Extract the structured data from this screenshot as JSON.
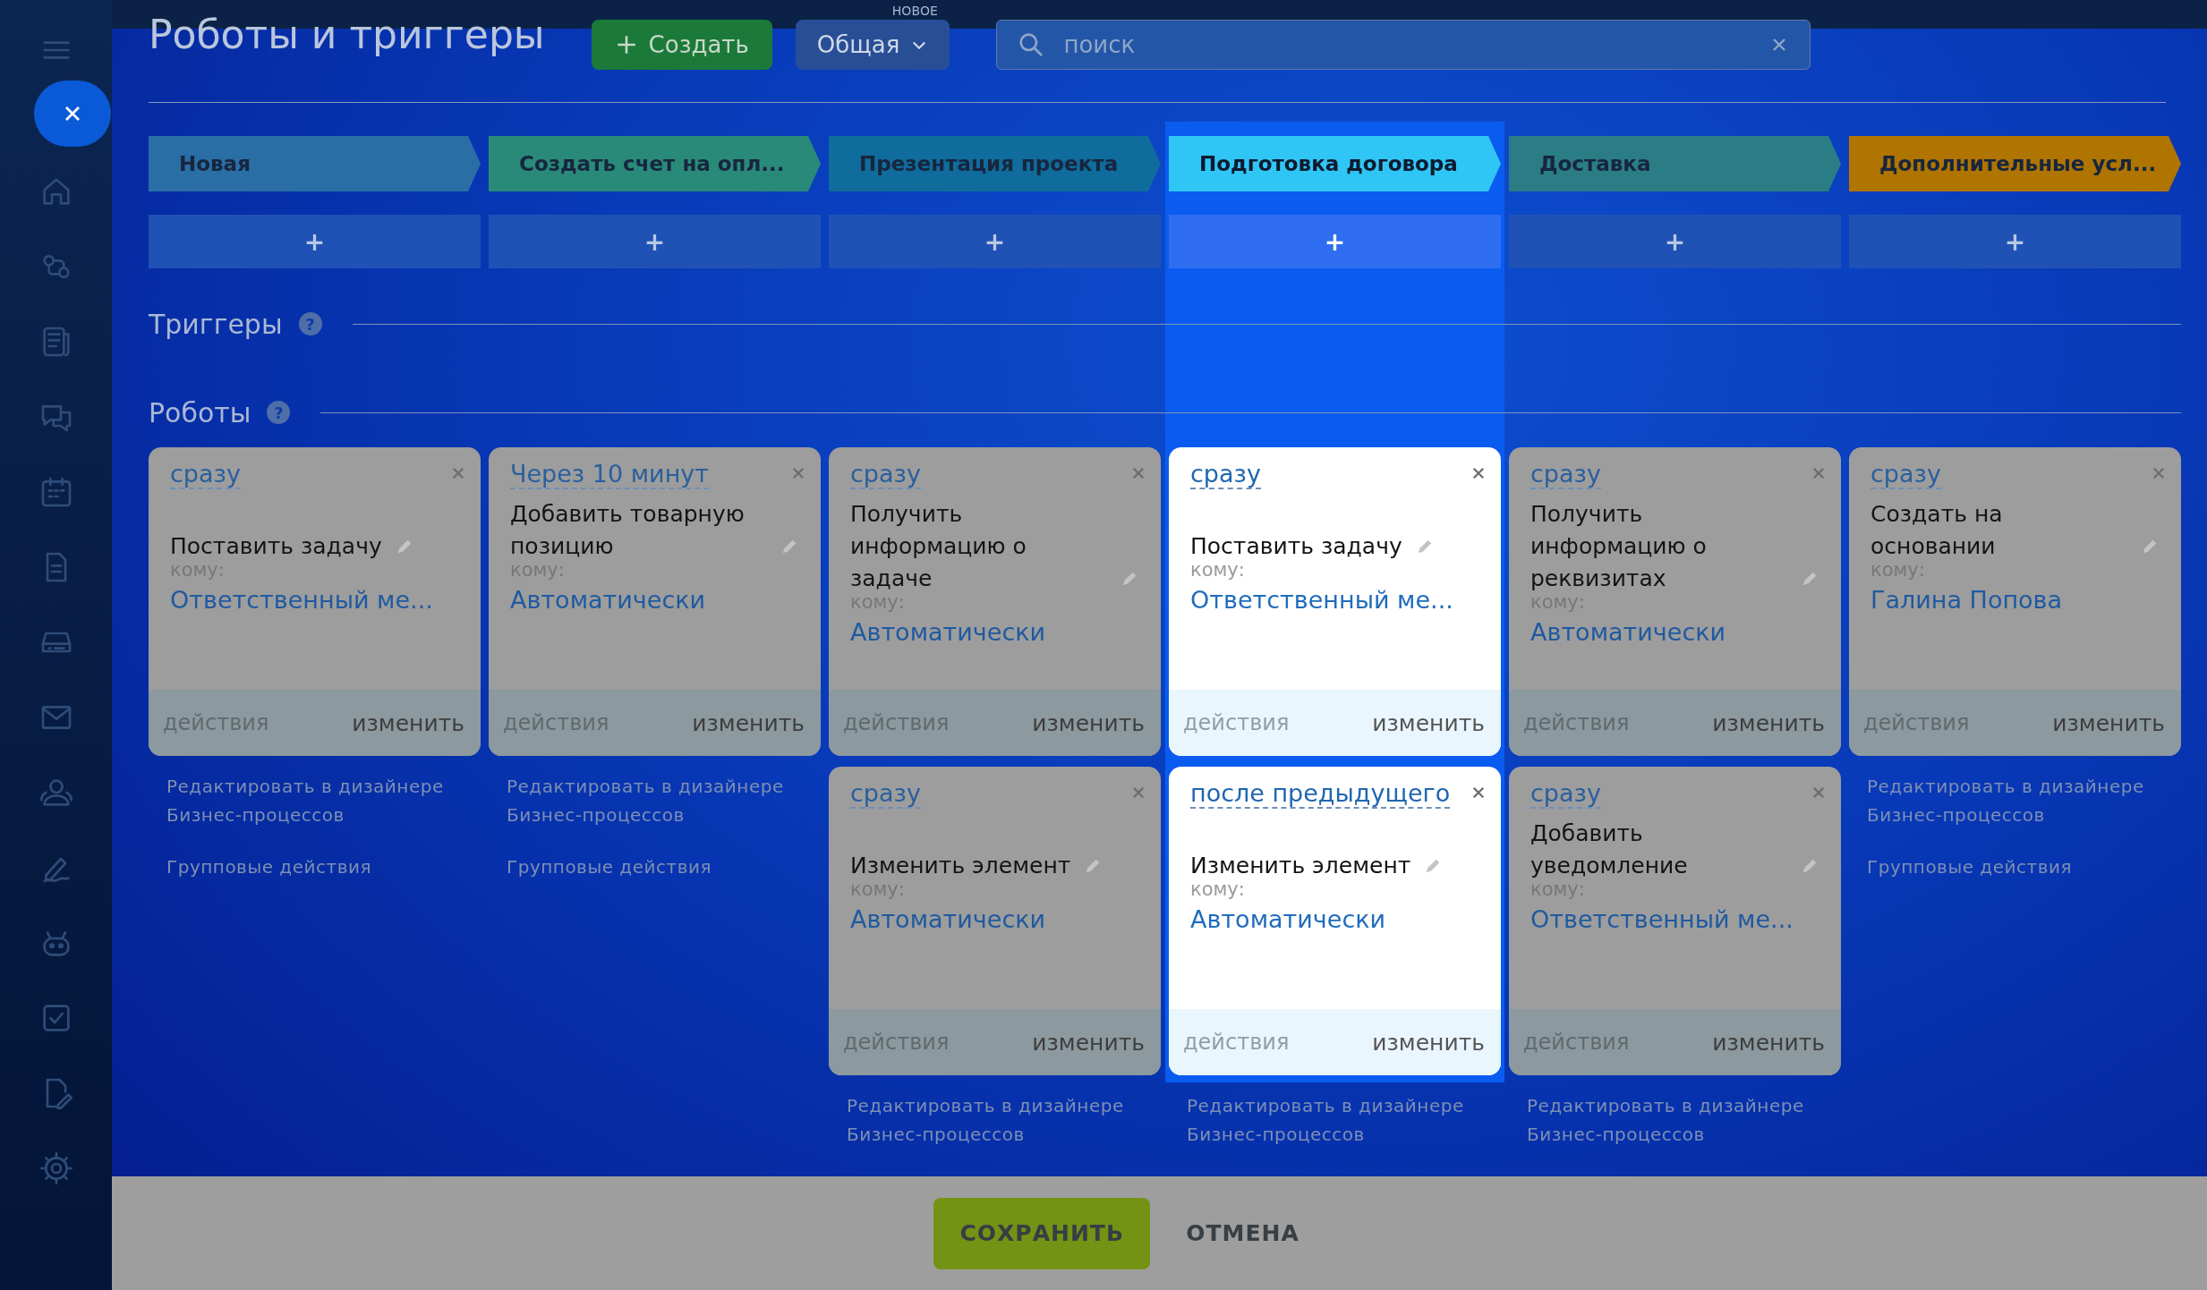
{
  "header": {
    "title": "Роботы и триггеры",
    "create_button": "Создать",
    "mode_badge": "НОВОЕ",
    "mode_button": "Общая",
    "search": {
      "placeholder": "поиск"
    }
  },
  "stages": [
    {
      "name": "Новая",
      "color": "#2a6ea6",
      "selected": false
    },
    {
      "name": "Создать счет на опл...",
      "color": "#2a8a7a",
      "selected": false
    },
    {
      "name": "Презентация проекта",
      "color": "#0f6c9c",
      "selected": false
    },
    {
      "name": "Подготовка договора",
      "color": "#2fc6f6",
      "selected": true
    },
    {
      "name": "Доставка",
      "color": "#2b7d85",
      "selected": false
    },
    {
      "name": "Дополнительные усл...",
      "color": "#b07400",
      "selected": false
    }
  ],
  "add_label": "+",
  "sections": [
    {
      "title": "Триггеры",
      "help": "?"
    },
    {
      "title": "Роботы",
      "help": "?"
    }
  ],
  "columns": [
    {
      "robots": [
        {
          "timing": "сразу",
          "action": "Поставить задачу",
          "to_label": "кому:",
          "to_value": "Ответственный ме...",
          "actions": "действия",
          "edit": "изменить"
        }
      ],
      "links": [
        "Редактировать в дизайнере Бизнес-процессов",
        "Групповые действия"
      ]
    },
    {
      "robots": [
        {
          "timing": "Через 10 минут",
          "action": "Добавить товарную позицию",
          "to_label": "кому:",
          "to_value": "Автоматически",
          "actions": "действия",
          "edit": "изменить"
        }
      ],
      "links": [
        "Редактировать в дизайнере Бизнес-процессов",
        "Групповые действия"
      ]
    },
    {
      "robots": [
        {
          "timing": "сразу",
          "action": "Получить информацию о задаче",
          "to_label": "кому:",
          "to_value": "Автоматически",
          "actions": "действия",
          "edit": "изменить"
        },
        {
          "timing": "сразу",
          "action": "Изменить элемент",
          "to_label": "кому:",
          "to_value": "Автоматически",
          "actions": "действия",
          "edit": "изменить"
        }
      ],
      "links": [
        "Редактировать в дизайнере Бизнес-процессов"
      ]
    },
    {
      "robots": [
        {
          "timing": "сразу",
          "action": "Поставить задачу",
          "to_label": "кому:",
          "to_value": "Ответственный ме...",
          "actions": "действия",
          "edit": "изменить"
        },
        {
          "timing": "после предыдущего",
          "action": "Изменить элемент",
          "to_label": "кому:",
          "to_value": "Автоматически",
          "actions": "действия",
          "edit": "изменить"
        }
      ],
      "links": [
        "Редактировать в дизайнере Бизнес-процессов"
      ]
    },
    {
      "robots": [
        {
          "timing": "сразу",
          "action": "Получить информацию о реквизитах",
          "to_label": "кому:",
          "to_value": "Автоматически",
          "actions": "действия",
          "edit": "изменить"
        },
        {
          "timing": "сразу",
          "action": "Добавить уведомление",
          "to_label": "кому:",
          "to_value": "Ответственный ме...",
          "actions": "действия",
          "edit": "изменить"
        }
      ],
      "links": [
        "Редактировать в дизайнере Бизнес-процессов"
      ]
    },
    {
      "robots": [
        {
          "timing": "сразу",
          "action": "Создать на основании",
          "to_label": "кому:",
          "to_value": "Галина Попова",
          "actions": "действия",
          "edit": "изменить"
        }
      ],
      "links": [
        "Редактировать в дизайнере Бизнес-процессов",
        "Групповые действия"
      ]
    }
  ],
  "footer": {
    "save": "СОХРАНИТЬ",
    "cancel": "ОТМЕНА"
  }
}
